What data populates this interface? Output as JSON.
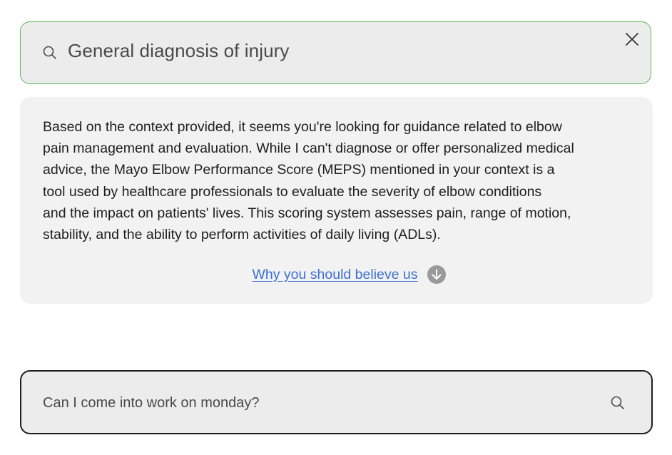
{
  "top_search": {
    "query": "General diagnosis of injury",
    "search_icon": "search-icon",
    "close_icon": "close-icon"
  },
  "answer": {
    "lines": [
      "Based on the context provided, it seems you're looking for guidance related to elbow",
      "pain management and evaluation. While I can't diagnose or offer personalized medical",
      "advice, the Mayo Elbow Performance Score (MEPS) mentioned in your context is a",
      "tool used by healthcare professionals to evaluate the severity of elbow conditions",
      "and the impact on patients' lives. This scoring system assesses pain, range of motion,",
      "stability, and the ability to perform activities of daily living (ADLs)."
    ],
    "believe_link": "Why you should believe us",
    "believe_icon": "arrow-down-circle-icon"
  },
  "bottom_search": {
    "placeholder": "Can I come into work on monday?",
    "search_icon": "search-icon"
  },
  "colors": {
    "active_border": "#5cb85c",
    "link": "#3b6fd4",
    "card_bg": "#f2f2f2",
    "input_bg": "#ececec",
    "icon_grey": "#9a9a9a"
  }
}
